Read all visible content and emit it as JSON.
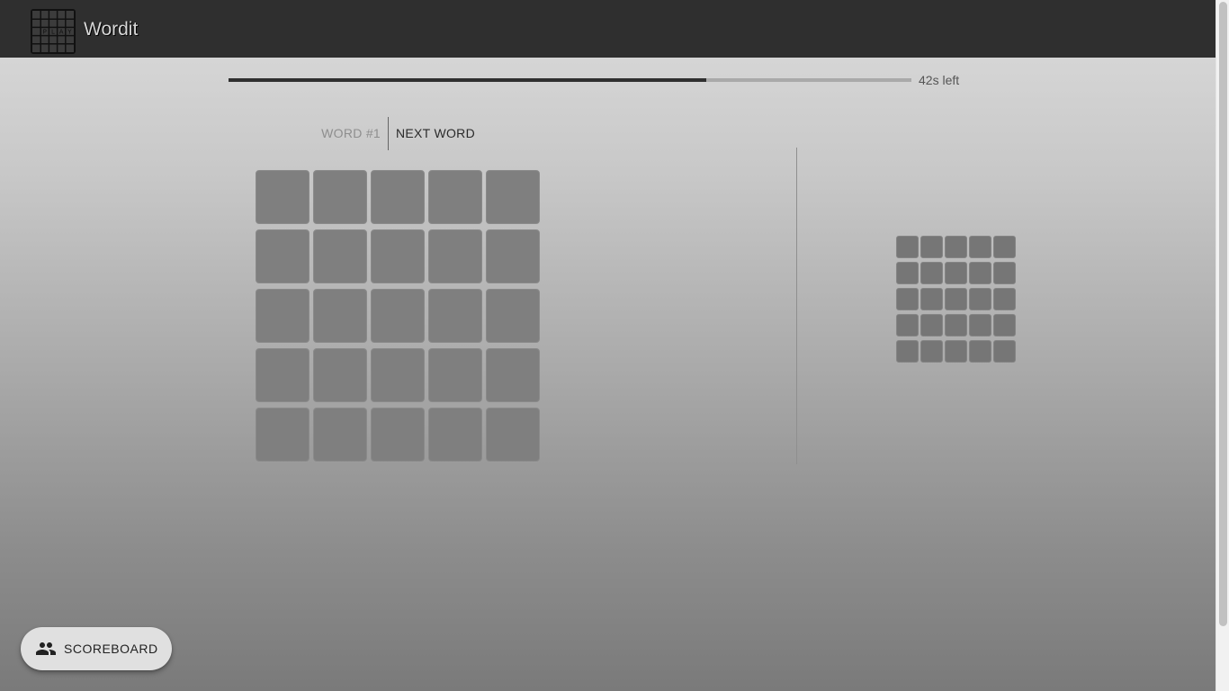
{
  "app": {
    "title": "Wordit",
    "logo_icon": "crossword-grid-logo",
    "logo_letters": "PLAY"
  },
  "timer": {
    "remaining_fraction": 0.7,
    "text": "42s left"
  },
  "tabs": {
    "current": "WORD #1",
    "next": "NEXT WORD"
  },
  "main_grid": {
    "rows": 5,
    "cols": 5,
    "cells": [
      "",
      "",
      "",
      "",
      "",
      "",
      "",
      "",
      "",
      "",
      "",
      "",
      "",
      "",
      "",
      "",
      "",
      "",
      "",
      "",
      "",
      "",
      "",
      "",
      ""
    ]
  },
  "mini_grid": {
    "rows": 5,
    "cols": 5
  },
  "scoreboard": {
    "label": "SCOREBOARD",
    "icon": "people-icon"
  },
  "colors": {
    "appbar": "#2f2f2f",
    "cell": "#7f7f7f",
    "timer_fill": "#2f2f2f"
  }
}
